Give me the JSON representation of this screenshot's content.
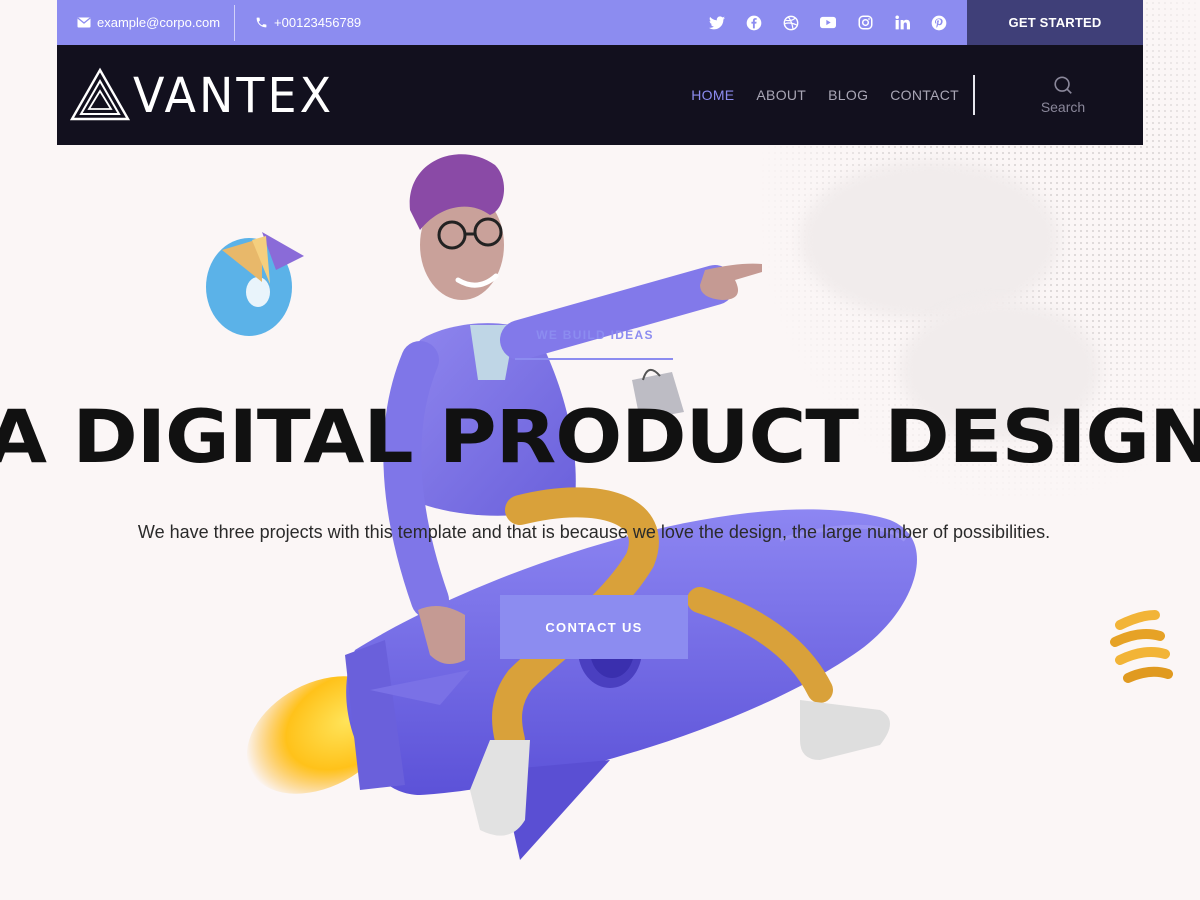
{
  "topbar": {
    "email": "example@corpo.com",
    "phone": "+00123456789",
    "socials": [
      "twitter-icon",
      "facebook-icon",
      "dribbble-icon",
      "youtube-icon",
      "instagram-icon",
      "linkedin-icon",
      "pinterest-icon"
    ],
    "cta_label": "GET STARTED"
  },
  "nav": {
    "logo_text": "VANTEX",
    "links": [
      {
        "label": "HOME",
        "active": true
      },
      {
        "label": "ABOUT",
        "active": false
      },
      {
        "label": "BLOG",
        "active": false
      },
      {
        "label": "CONTACT",
        "active": false
      }
    ],
    "search_label": "Search"
  },
  "hero": {
    "tagline": "WE BUILD IDEAS",
    "headline": "A DIGITAL PRODUCT DESIGN",
    "subtext": "We have three projects with this template and that is because we love the design, the large number of possibilities.",
    "cta_label": "CONTACT US"
  },
  "colors": {
    "accent": "#8c8cf0",
    "topbar_dark": "#3f3f78",
    "nav_bg": "#12101e",
    "page_bg": "#fbf6f6"
  }
}
